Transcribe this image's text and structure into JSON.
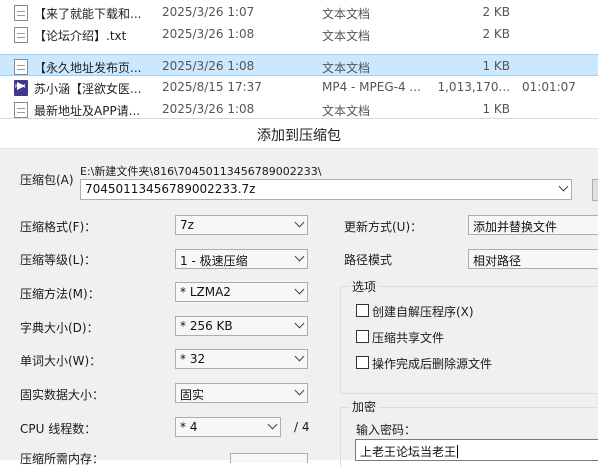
{
  "files": [
    {
      "name": "【来了就能下载和...",
      "date": "2025/3/26 1:07",
      "type": "文本文档",
      "size": "2 KB",
      "duration": "",
      "icon": "txt-icon",
      "selected": false
    },
    {
      "name": "【论坛介绍】.txt",
      "date": "2025/3/26 1:08",
      "type": "文本文档",
      "size": "2 KB",
      "duration": "",
      "icon": "txt-icon",
      "selected": false
    },
    {
      "name": "【永久地址发布页...",
      "date": "2025/3/26 1:08",
      "type": "文本文档",
      "size": "1 KB",
      "duration": "",
      "icon": "txt-icon",
      "selected": true
    },
    {
      "name": "苏小涵【淫欲女医...",
      "date": "2025/8/15 17:37",
      "type": "MP4 - MPEG-4 ...",
      "size": "1,013,170...",
      "duration": "01:01:07",
      "icon": "mp4-icon",
      "selected": false
    },
    {
      "name": "最新地址及APP请...",
      "date": "2025/3/26 1:08",
      "type": "文本文档",
      "size": "1 KB",
      "duration": "",
      "icon": "txt-icon",
      "selected": false
    }
  ],
  "mp4_icon_label": "MP4",
  "dialog": {
    "title": "添加到压缩包",
    "archive_label": "压缩包(A)",
    "archive_path": "E:\\新建文件夹\\816\\70450113456789002233\\",
    "archive_name": "70450113456789002233.7z",
    "left": {
      "format_label": "压缩格式(F)：",
      "format_value": "7z",
      "level_label": "压缩等级(L)：",
      "level_value": "1 - 极速压缩",
      "method_label": "压缩方法(M)：",
      "method_value": "* LZMA2",
      "dict_label": "字典大小(D)：",
      "dict_value": "* 256 KB",
      "word_label": "单词大小(W)：",
      "word_value": "* 32",
      "solid_label": "固实数据大小：",
      "solid_value": "固实",
      "cpu_label": "CPU 线程数：",
      "cpu_value": "* 4",
      "cpu_total": "/ 4",
      "mem_label": "压缩所需内存："
    },
    "right": {
      "update_label": "更新方式(U)：",
      "update_value": "添加并替换文件",
      "path_label": "路径模式",
      "path_value": "相对路径",
      "options_title": "选项",
      "opt_sfx": "创建自解压程序(X)",
      "opt_shared": "压缩共享文件",
      "opt_delete": "操作完成后删除源文件",
      "encrypt_title": "加密",
      "password_label": "输入密码：",
      "password_value": "上老王论坛当老王"
    }
  }
}
